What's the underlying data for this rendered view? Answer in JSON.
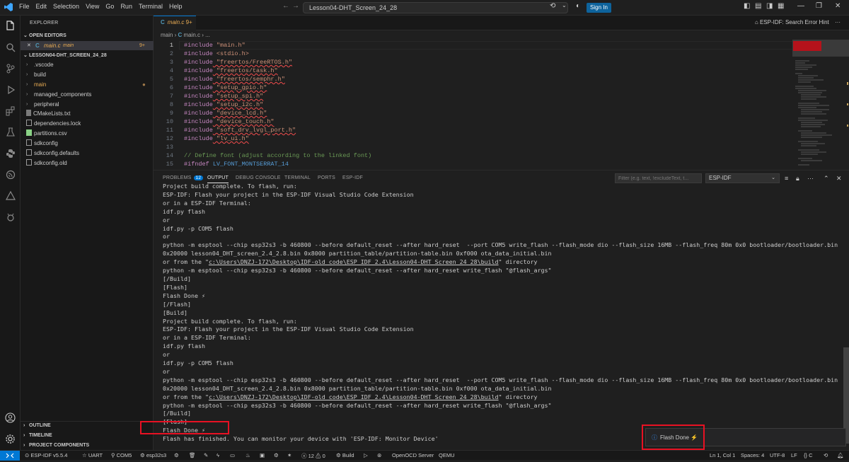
{
  "titlebar": {
    "menu": [
      "File",
      "Edit",
      "Selection",
      "View",
      "Go",
      "Run",
      "Terminal",
      "Help"
    ],
    "search": "Lesson04-DHT_Screen_24_28",
    "sign_in": "Sign In"
  },
  "sidebar": {
    "title": "EXPLORER",
    "open_editors": "OPEN EDITORS",
    "open_file": {
      "name": "main.c",
      "folder": "main",
      "badge": "9+"
    },
    "project": "LESSON04-DHT_SCREEN_24_28",
    "folders": [
      ".vscode",
      "build",
      "main",
      "managed_components",
      "peripheral"
    ],
    "files": [
      "CMakeLists.txt",
      "dependencies.lock",
      "partitions.csv",
      "sdkconfig",
      "sdkconfig.defaults",
      "sdkconfig.old"
    ],
    "outline": "OUTLINE",
    "timeline": "TIMELINE",
    "project_components": "PROJECT COMPONENTS"
  },
  "editor": {
    "tab_name": "main.c",
    "tab_badge": "9+",
    "crumb_folder": "main",
    "crumb_file": "main.c",
    "crumb_more": "...",
    "hint": "ESP-IDF: Search Error Hint",
    "lines": [
      {
        "n": "1",
        "pre": "#include",
        "arg": " \"main.h\""
      },
      {
        "n": "2",
        "pre": "#include",
        "arg": " <stdio.h>"
      },
      {
        "n": "3",
        "pre": "#include",
        "arg": " \"freertos/FreeRTOS.h\""
      },
      {
        "n": "4",
        "pre": "#include",
        "arg": " \"freertos/task.h\""
      },
      {
        "n": "5",
        "pre": "#include",
        "arg": " \"freertos/semphr.h\""
      },
      {
        "n": "6",
        "pre": "#include",
        "arg": " \"setup_gpio.h\""
      },
      {
        "n": "7",
        "pre": "#include",
        "arg": " \"setup_spi.h\""
      },
      {
        "n": "8",
        "pre": "#include",
        "arg": " \"setup_i2c.h\""
      },
      {
        "n": "9",
        "pre": "#include",
        "arg": " \"device_lcd.h\""
      },
      {
        "n": "10",
        "pre": "#include",
        "arg": " \"device_touch.h\""
      },
      {
        "n": "11",
        "pre": "#include",
        "arg": " \"soft_drv_lvgl_port.h\""
      },
      {
        "n": "12",
        "pre": "#include",
        "arg": " \"lv_ui.h\""
      },
      {
        "n": "13",
        "pre": "",
        "arg": ""
      },
      {
        "n": "14",
        "pre": "// Define font (adjust according to the linked font)",
        "arg": ""
      },
      {
        "n": "15",
        "pre": "#ifndef",
        "arg": " LV_FONT_MONTSERRAT_14"
      }
    ]
  },
  "panel": {
    "tabs": {
      "problems": "PROBLEMS",
      "problems_count": "12",
      "output": "OUTPUT",
      "debug": "DEBUG CONSOLE",
      "terminal": "TERMINAL",
      "ports": "PORTS",
      "espidf": "ESP-IDF"
    },
    "filter_placeholder": "Filter (e.g. text, !excludeText, t...",
    "channel": "ESP-IDF",
    "output": [
      "Project build complete. To flash, run:",
      "ESP-IDF: Flash your project in the ESP-IDF Visual Studio Code Extension",
      "or in a ESP-IDF Terminal:",
      "idf.py flash",
      "or",
      "idf.py -p COM5 flash",
      "or",
      "python -m esptool --chip esp32s3 -b 460800 --before default_reset --after hard_reset  --port COM5 write_flash --flash_mode dio --flash_size 16MB --flash_freq 80m 0x0 bootloader/bootloader.bin",
      "0x20000 lesson04_DHT_screen_2.4_2.8.bin 0x8000 partition_table/partition-table.bin 0xf000 ota_data_initial.bin",
      "or from the \"c:\\Users\\DNZJ-172\\Desktop\\IDF-old_code\\ESP_IDF_2.4\\Lesson04-DHT_Screen_24_28\\build\" directory",
      "python -m esptool --chip esp32s3 -b 460800 --before default_reset --after hard_reset write_flash \"@flash_args\"",
      "[/Build]",
      "[Flash]",
      "Flash Done ⚡",
      "[/Flash]",
      "[Build]",
      "Project build complete. To flash, run:",
      "ESP-IDF: Flash your project in the ESP-IDF Visual Studio Code Extension",
      "or in a ESP-IDF Terminal:",
      "idf.py flash",
      "or",
      "idf.py -p COM5 flash",
      "or",
      "python -m esptool --chip esp32s3 -b 460800 --before default_reset --after hard_reset  --port COM5 write_flash --flash_mode dio --flash_size 16MB --flash_freq 80m 0x0 bootloader/bootloader.bin",
      "0x20000 lesson04_DHT_screen_2.4_2.8.bin 0x8000 partition_table/partition-table.bin 0xf000 ota_data_initial.bin",
      "or from the \"c:\\Users\\DNZJ-172\\Desktop\\IDF-old_code\\ESP_IDF_2.4\\Lesson04-DHT_Screen_24_28\\build\" directory",
      "python -m esptool --chip esp32s3 -b 460800 --before default_reset --after hard_reset write_flash \"@flash_args\"",
      "[/Build]",
      "[Flash]",
      "Flash Done ⚡",
      "Flash has finished. You can monitor your device with 'ESP-IDF: Monitor Device'"
    ]
  },
  "toast": {
    "message": "Flash Done ⚡"
  },
  "statusbar": {
    "idf_version": "ESP-IDF v5.5.4",
    "uart": "UART",
    "port": "COM5",
    "target": "esp32s3",
    "problems": "12",
    "warnings": "0",
    "build": "Build",
    "openocd": "OpenOCD Server",
    "qemu": "QEMU",
    "position": "Ln 1, Col 1",
    "spaces": "Spaces: 4",
    "encoding": "UTF-8",
    "eol": "LF",
    "language": "C"
  },
  "colors": {
    "accent": "#0078d4",
    "highlight": "#e81123",
    "modified": "#e8ab53"
  }
}
